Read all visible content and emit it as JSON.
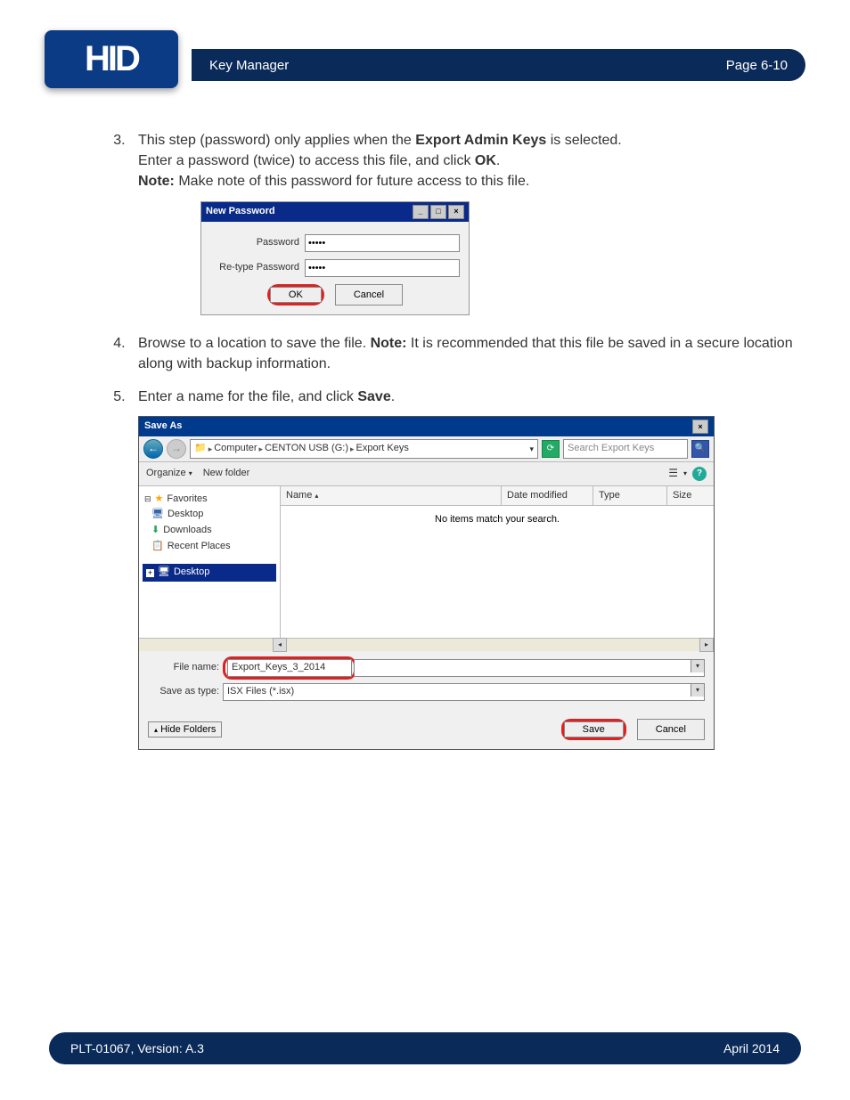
{
  "header": {
    "title": "Key Manager",
    "page": "Page 6-10"
  },
  "logo": "HID",
  "steps": {
    "s3": {
      "line1a": "This step (password) only applies when the ",
      "bold1": "Export Admin Keys",
      "line1b": " is selected.",
      "line2a": "Enter a password (twice) to access this file, and click ",
      "bold2": "OK",
      "line2b": ".",
      "note_label": "Note:",
      "note_text": " Make note of this password for future access to this file."
    },
    "s4": {
      "text_a": "Browse to a location to save the file. ",
      "note_label": "Note:",
      "text_b": " It is recommended that this file be saved in a secure location along with backup information."
    },
    "s5": {
      "text_a": "Enter a name for the file, and click ",
      "bold": "Save",
      "text_b": "."
    }
  },
  "password_dialog": {
    "title": "New Password",
    "label_pw": "Password",
    "label_rpw": "Re-type Password",
    "masked": "•••••",
    "ok": "OK",
    "cancel": "Cancel"
  },
  "save_dialog": {
    "title": "Save As",
    "breadcrumb": {
      "p1": "Computer",
      "p2": "CENTON USB (G:)",
      "p3": "Export Keys"
    },
    "search_placeholder": "Search Export Keys",
    "toolbar": {
      "organize": "Organize",
      "newfolder": "New folder"
    },
    "tree": {
      "favorites": "Favorites",
      "desktop": "Desktop",
      "downloads": "Downloads",
      "recent": "Recent Places",
      "desktop_sel": "Desktop"
    },
    "columns": {
      "name": "Name",
      "date": "Date modified",
      "type": "Type",
      "size": "Size"
    },
    "empty": "No items match your search.",
    "file_name_label": "File name:",
    "file_name_value": "Export_Keys_3_2014",
    "save_type_label": "Save as type:",
    "save_type_value": "ISX Files (*.isx)",
    "hide_folders": "Hide Folders",
    "save": "Save",
    "cancel": "Cancel"
  },
  "footer": {
    "left": "PLT-01067, Version: A.3",
    "right": "April 2014"
  }
}
